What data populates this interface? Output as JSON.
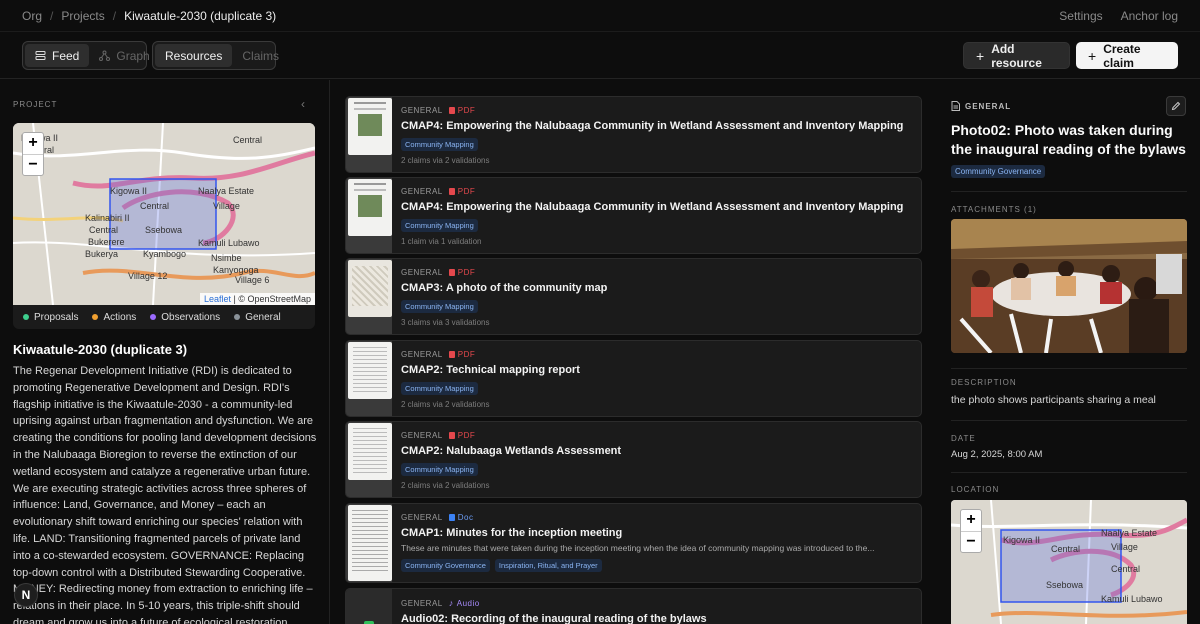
{
  "breadcrumb": {
    "items": [
      "Org",
      "Projects",
      "Kiwaatule-2030 (duplicate 3)"
    ]
  },
  "top_links": {
    "settings": "Settings",
    "anchor_log": "Anchor log"
  },
  "view_toggle": {
    "feed": "Feed",
    "graph": "Graph"
  },
  "content_toggle": {
    "resources": "Resources",
    "claims": "Claims"
  },
  "actions": {
    "add_resource": "Add resource",
    "create_claim": "Create claim"
  },
  "project": {
    "section_label": "PROJECT",
    "title": "Kiwaatule-2030 (duplicate 3)",
    "description": "The Regenar Development Initiative (RDI) is dedicated to promoting Regenerative Development and Design. RDI's flagship initiative is the Kiwaatule-2030 - a community-led uprising against urban fragmentation and dysfunction. We are creating the conditions for pooling land development decisions in the Nalubaaga Bioregion to reverse the extinction of our wetland ecosystem and catalyze a regenerative urban future. We are executing strategic activities across three spheres of influence: Land, Governance, and Money – each an evolutionary shift toward enriching our species' relation with life. LAND: Transitioning fragmented parcels of private land into a co-stewarded ecosystem. GOVERNANCE: Replacing top-down control with a Distributed Stewarding Cooperative. MONEY: Redirecting money from extraction to enriching life – relations in their place. In 5-10 years, this triple-shift should dream and grow us into a future of ecological restoration, reforesting, and"
  },
  "map": {
    "zoom_in": "+",
    "zoom_out": "−",
    "attribution_leaflet": "Leaflet",
    "attribution_osm": "| © OpenStreetMap",
    "labels": [
      "Kigowa II",
      "Naalya Estate",
      "Village",
      "Central",
      "Kalinabiri II",
      "Central",
      "Bukerere",
      "Ssebowa",
      "Kamuli Lubawo",
      "Bukerya",
      "Kyambogo",
      "Nsimbe",
      "Village 12",
      "Kanyogoga",
      "Central",
      "Village 6"
    ]
  },
  "legend": [
    {
      "label": "Proposals",
      "color": "#3ecf8e"
    },
    {
      "label": "Actions",
      "color": "#f0a030"
    },
    {
      "label": "Observations",
      "color": "#9b6bff"
    },
    {
      "label": "General",
      "color": "#8a9299"
    }
  ],
  "fab": {
    "label": "N"
  },
  "resources": [
    {
      "category": "GENERAL",
      "type": "PDF",
      "title": "CMAP4: Empowering the Nalubaaga Community in Wetland Assessment and Inventory Mapping",
      "description": "",
      "tags": [
        "Community Mapping"
      ],
      "footer": "2 claims via 2 validations"
    },
    {
      "category": "GENERAL",
      "type": "PDF",
      "title": "CMAP4: Empowering the Nalubaaga Community in Wetland Assessment and Inventory Mapping",
      "description": "",
      "tags": [
        "Community Mapping"
      ],
      "footer": "1 claim via 1 validation"
    },
    {
      "category": "GENERAL",
      "type": "PDF",
      "title": "CMAP3: A photo of the community map",
      "description": "",
      "tags": [
        "Community Mapping"
      ],
      "footer": "3 claims via 3 validations"
    },
    {
      "category": "GENERAL",
      "type": "PDF",
      "title": "CMAP2: Technical mapping report",
      "description": "",
      "tags": [
        "Community Mapping"
      ],
      "footer": "2 claims via 2 validations"
    },
    {
      "category": "GENERAL",
      "type": "PDF",
      "title": "CMAP2: Nalubaaga Wetlands Assessment",
      "description": "",
      "tags": [
        "Community Mapping"
      ],
      "footer": "2 claims via 2 validations"
    },
    {
      "category": "GENERAL",
      "type": "Doc",
      "title": "CMAP1: Minutes for the inception meeting",
      "description": "These are minutes that were taken during the inception meeting when the idea of community mapping was introduced to the...",
      "tags": [
        "Community Governance",
        "Inspiration, Ritual, and Prayer"
      ],
      "footer": ""
    },
    {
      "category": "GENERAL",
      "type": "Audio",
      "title": "Audio02: Recording of the inaugural reading of the bylaws",
      "description": "",
      "tags": [],
      "footer": ""
    }
  ],
  "detail": {
    "category": "GENERAL",
    "title": "Photo02: Photo was taken during the inaugural reading of the bylaws",
    "tag": "Community Governance",
    "attachments_label": "ATTACHMENTS (1)",
    "description_label": "DESCRIPTION",
    "description": "the photo shows participants sharing a meal",
    "date_label": "DATE",
    "date": "Aug 2, 2025, 8:00 AM",
    "location_label": "LOCATION"
  },
  "colors": {
    "pdf": "#e5484d",
    "doc": "#3b82f6",
    "audio": "#8b5cf6",
    "tag_bg": "#1c2a40",
    "tag_fg": "#8ab4f2"
  }
}
